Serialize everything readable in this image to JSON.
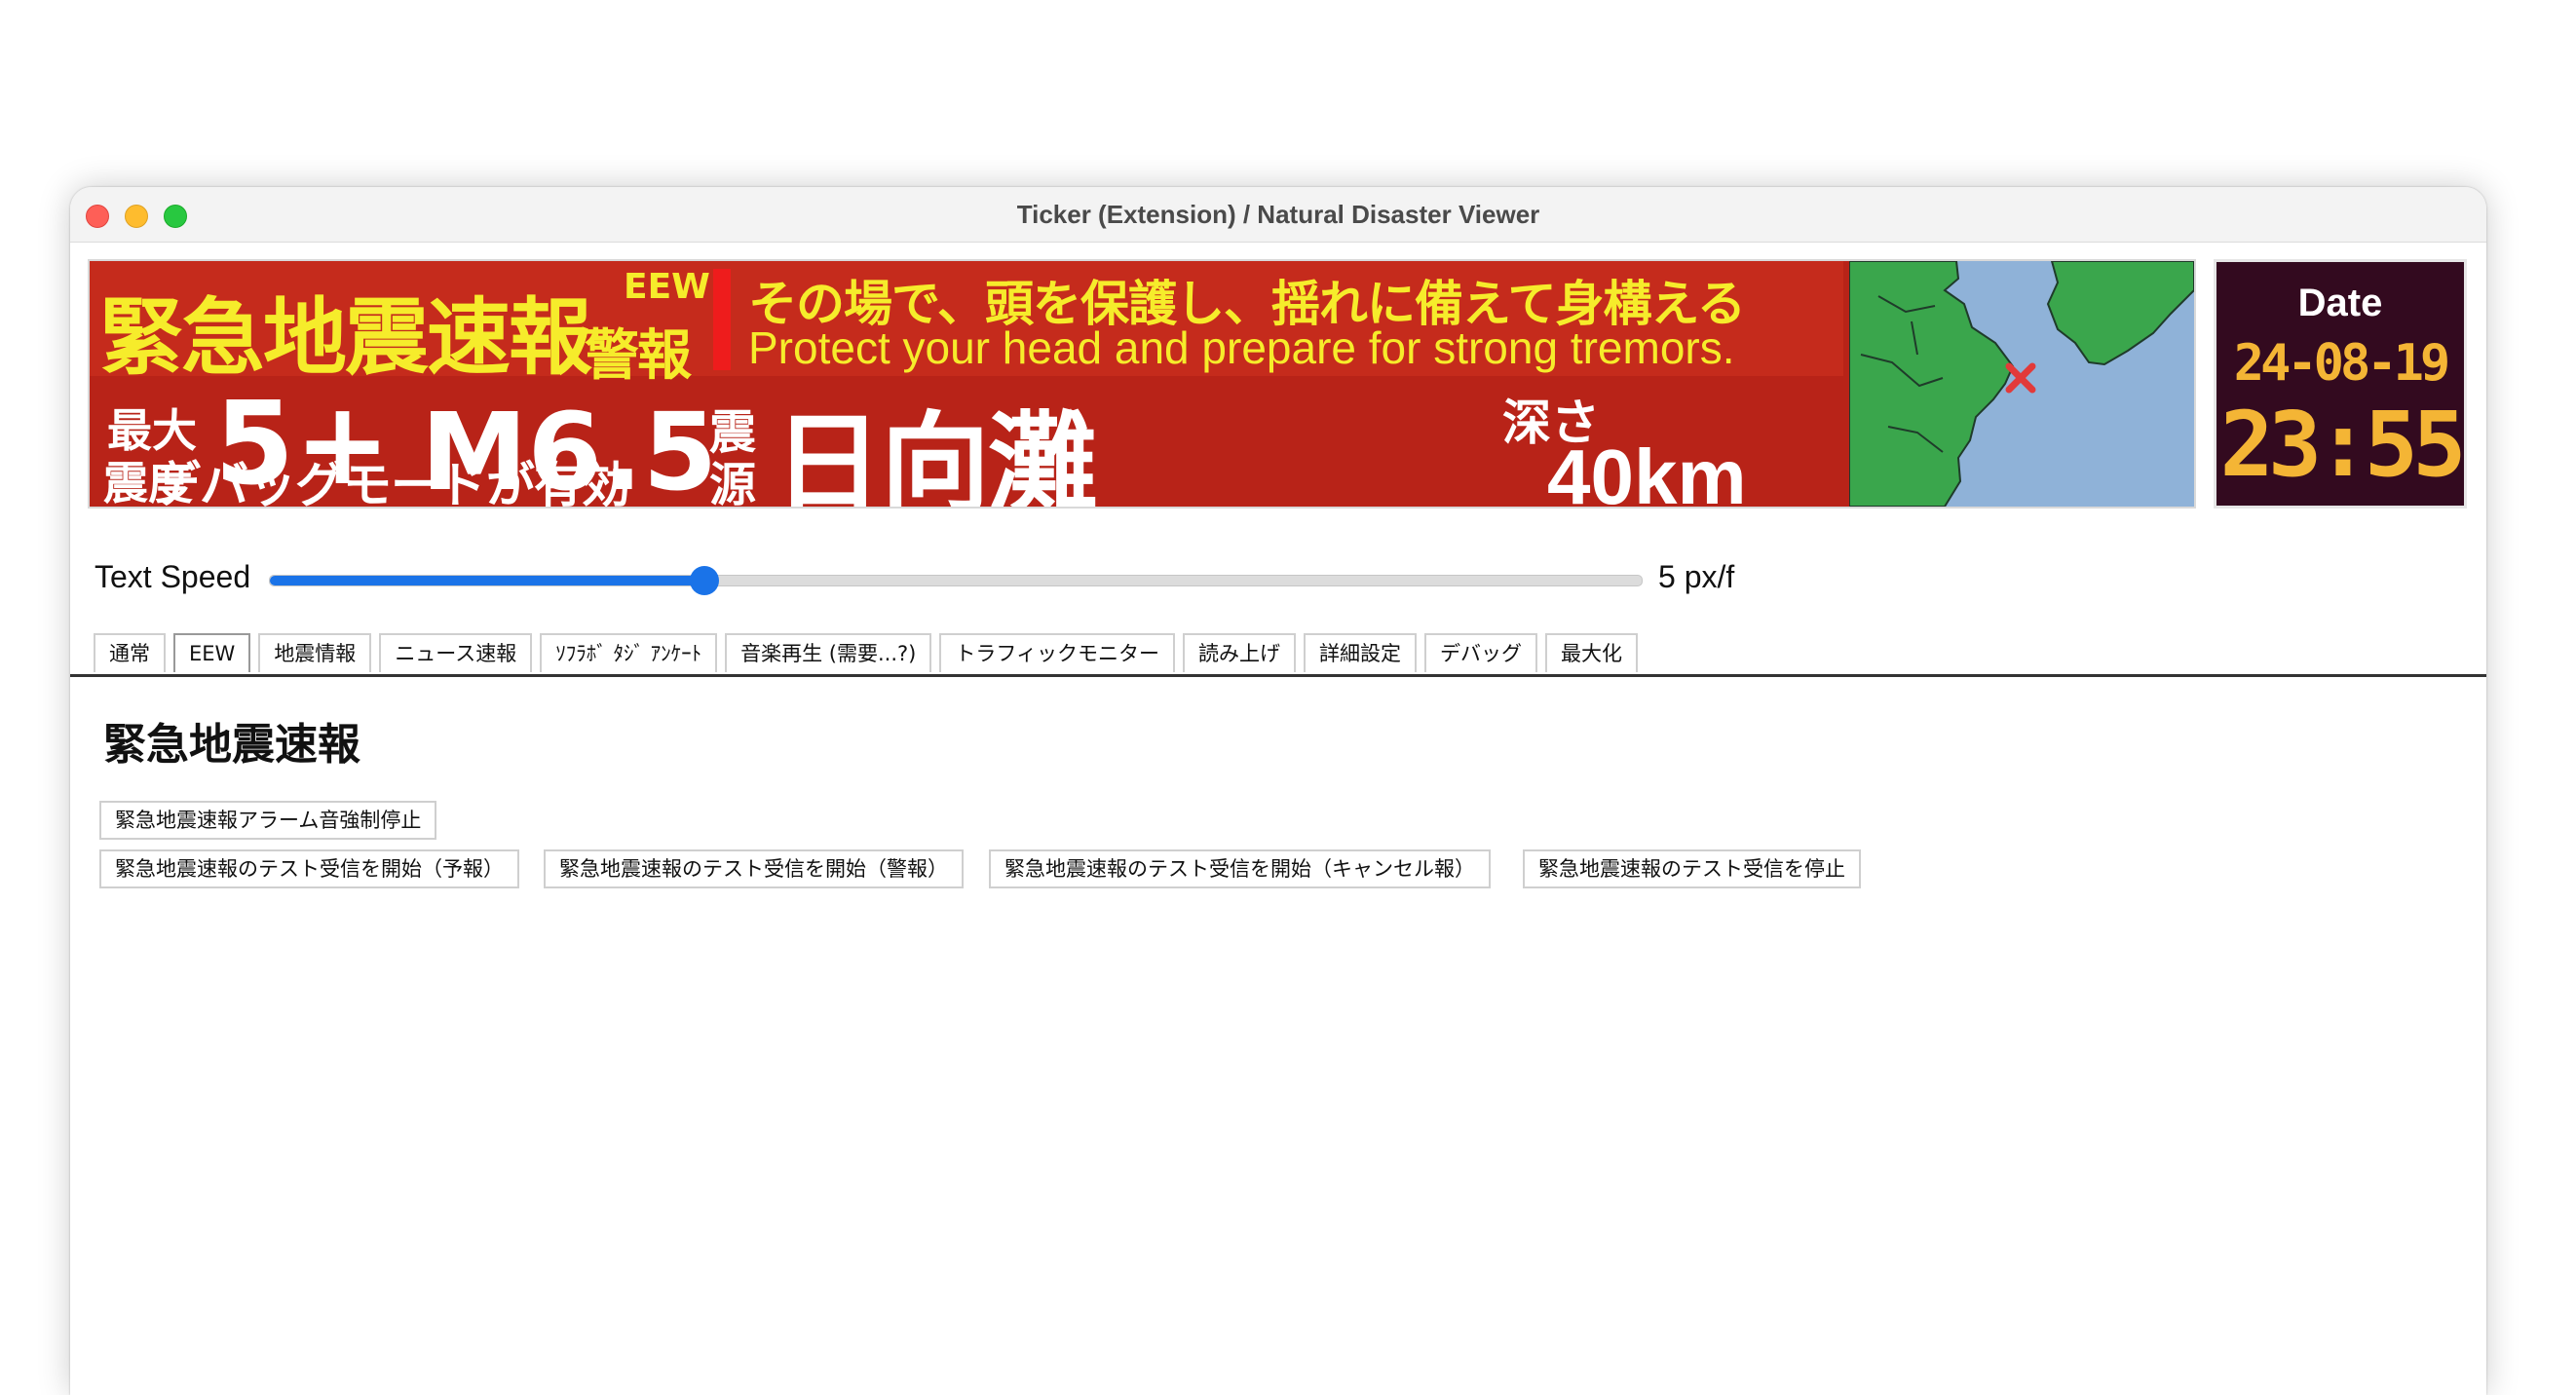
{
  "window": {
    "title": "Ticker (Extension) / Natural Disaster Viewer"
  },
  "ticker": {
    "title": "緊急地震速報",
    "eew": "EEW",
    "warning": "警報",
    "message_jp": "その場で、頭を保護し、揺れに備えて身構える",
    "message_en": "Protect your head and prepare for strong tremors.",
    "max_label": "最大",
    "intensity_label": "震度",
    "intensity": "5+",
    "magnitude": "M6.5",
    "debug_overlay": "デバッグモードが有効",
    "epicenter_label_1": "震",
    "epicenter_label_2": "源",
    "epicenter": "日向灘",
    "depth_label": "深さ",
    "depth": "40km",
    "map_colors": {
      "sea": "#8fb2d8",
      "land": "#3aa64c"
    }
  },
  "clock": {
    "label": "Date",
    "date": "24-08-19",
    "time": "23:55"
  },
  "speed": {
    "label": "Text Speed",
    "value_text": "5 px/f",
    "fraction": 0.317
  },
  "tabs": [
    "通常",
    "EEW",
    "地震情報",
    "ニュース速報",
    "ｿﾌﾗﾎﾞ ﾀｼﾞ ｱﾝｹｰﾄ",
    "音楽再生 (需要...?)",
    "トラフィックモニター",
    "読み上げ",
    "詳細設定",
    "デバッグ",
    "最大化"
  ],
  "active_tab": "EEW",
  "section": {
    "title": "緊急地震速報",
    "buttons": {
      "stop_alarm": "緊急地震速報アラーム音強制停止",
      "test_forecast": "緊急地震速報のテスト受信を開始（予報）",
      "test_warning": "緊急地震速報のテスト受信を開始（警報）",
      "test_cancel": "緊急地震速報のテスト受信を開始（キャンセル報）",
      "test_stop": "緊急地震速報のテスト受信を停止"
    }
  }
}
